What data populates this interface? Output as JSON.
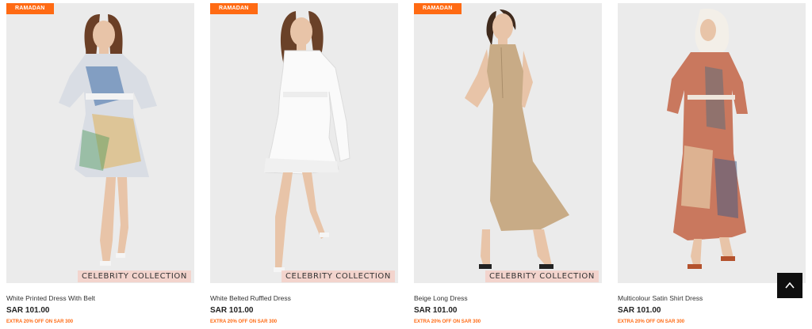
{
  "products": [
    {
      "badge": "RAMADAN",
      "collection": "CELEBRITY COLLECTION",
      "title": "White Printed Dress With Belt",
      "price": "SAR 101.00",
      "promo": "EXTRA 20% OFF ON SAR 300"
    },
    {
      "badge": "RAMADAN",
      "collection": "CELEBRITY COLLECTION",
      "title": "White Belted Ruffled Dress",
      "price": "SAR 101.00",
      "promo": "EXTRA 20% OFF ON SAR 300"
    },
    {
      "badge": "RAMADAN",
      "collection": "CELEBRITY COLLECTION",
      "title": "Beige Long Dress",
      "price": "SAR 101.00",
      "promo": "EXTRA 20% OFF ON SAR 300"
    },
    {
      "badge": "",
      "collection": "",
      "title": "Multicolour Satin Shirt Dress",
      "price": "SAR 101.00",
      "promo": "EXTRA 20% OFF ON SAR 300"
    }
  ],
  "scroll_top": {
    "icon": "chevron-up-icon"
  },
  "colors": {
    "accent": "#ff6a13",
    "badge_text": "#ffffff",
    "price": "#222222",
    "scroll_button": "#0f0f0f"
  }
}
